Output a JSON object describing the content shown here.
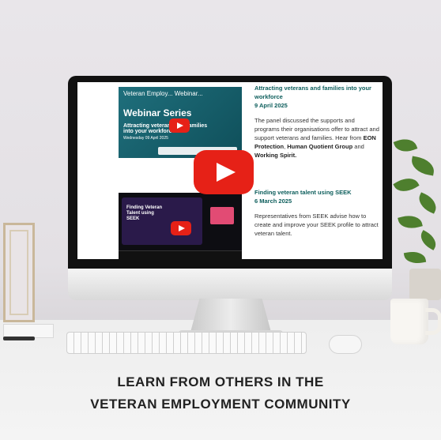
{
  "video1": {
    "title_bar": "Veteran Employ... Webinar...",
    "series": "Webinar Series",
    "subtitle": "Attracting veterans and families into your workforce",
    "date": "Wednesday 09 April 2025"
  },
  "video2": {
    "title": "Finding Veteran Talent using SEEK"
  },
  "article1": {
    "heading": "Attracting veterans and families into your workforce",
    "date": "9 April 2025",
    "body_intro": "The panel discussed the supports and programs their organisations offer to attract and support veterans and families. Hear from",
    "org1": "EON Protection",
    "org2": "Human Quotient Group",
    "conj": "and",
    "org3": "Working Spirit."
  },
  "article2": {
    "heading": "Finding veteran talent using SEEK",
    "date": "6 March 2025",
    "body": "Representatives from SEEK advise how to create and improve your SEEK profile to attract veteran talent."
  },
  "caption": {
    "line1": "LEARN FROM OTHERS IN THE",
    "line2": "VETERAN EMPLOYMENT COMMUNITY"
  },
  "colors": {
    "play": "#e62117",
    "heading": "#0d5e5c"
  }
}
